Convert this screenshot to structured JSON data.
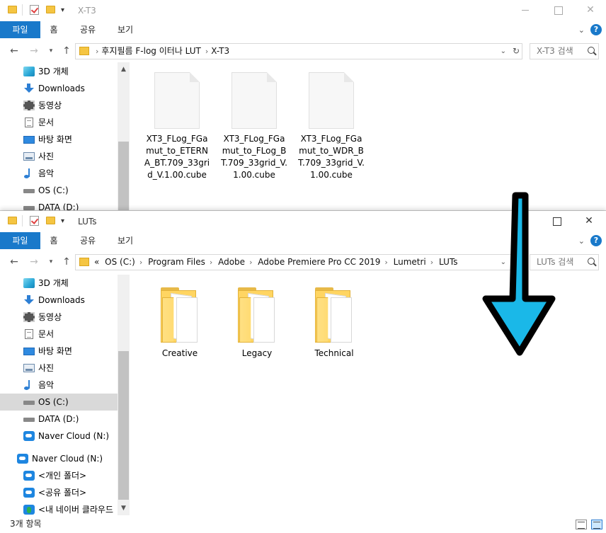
{
  "window_top": {
    "title": "X-T3",
    "ribbon_tabs": [
      "파일",
      "홈",
      "공유",
      "보기"
    ],
    "address_crumbs": [
      "후지필름 F-log 이터나 LUT",
      "X-T3"
    ],
    "search_placeholder": "X-T3 검색",
    "sidebar_items": [
      {
        "label": "3D 개체",
        "icon": "3d-objects-icon"
      },
      {
        "label": "Downloads",
        "icon": "download-icon"
      },
      {
        "label": "동영상",
        "icon": "video-icon"
      },
      {
        "label": "문서",
        "icon": "document-icon"
      },
      {
        "label": "바탕 화면",
        "icon": "desktop-icon"
      },
      {
        "label": "사진",
        "icon": "pictures-icon"
      },
      {
        "label": "음악",
        "icon": "music-icon"
      },
      {
        "label": "OS (C:)",
        "icon": "windows-drive-icon"
      },
      {
        "label": "DATA (D:)",
        "icon": "drive-icon"
      }
    ],
    "files": [
      {
        "name": "XT3_FLog_FGamut_to_ETERNA_BT.709_33grid_V.1.00.cube",
        "icon": "cube-file-icon"
      },
      {
        "name": "XT3_FLog_FGamut_to_FLog_BT.709_33grid_V.1.00.cube",
        "icon": "cube-file-icon"
      },
      {
        "name": "XT3_FLog_FGamut_to_WDR_BT.709_33grid_V.1.00.cube",
        "icon": "cube-file-icon"
      }
    ]
  },
  "window_bottom": {
    "title": "LUTs",
    "ribbon_tabs": [
      "파일",
      "홈",
      "공유",
      "보기"
    ],
    "address_overflow": "«",
    "address_crumbs": [
      "OS (C:)",
      "Program Files",
      "Adobe",
      "Adobe Premiere Pro CC 2019",
      "Lumetri",
      "LUTs"
    ],
    "search_placeholder": "LUTs 검색",
    "sidebar_items": [
      {
        "label": "3D 개체",
        "icon": "3d-objects-icon",
        "level": 1
      },
      {
        "label": "Downloads",
        "icon": "download-icon",
        "level": 1
      },
      {
        "label": "동영상",
        "icon": "video-icon",
        "level": 1
      },
      {
        "label": "문서",
        "icon": "document-icon",
        "level": 1
      },
      {
        "label": "바탕 화면",
        "icon": "desktop-icon",
        "level": 1
      },
      {
        "label": "사진",
        "icon": "pictures-icon",
        "level": 1
      },
      {
        "label": "음악",
        "icon": "music-icon",
        "level": 1
      },
      {
        "label": "OS (C:)",
        "icon": "windows-drive-icon",
        "level": 1,
        "selected": true
      },
      {
        "label": "DATA (D:)",
        "icon": "drive-icon",
        "level": 1
      },
      {
        "label": "Naver Cloud (N:)",
        "icon": "naver-cloud-icon",
        "level": 1
      },
      {
        "label": "Naver Cloud (N:)",
        "icon": "naver-cloud-icon",
        "level": 0
      },
      {
        "label": "<개인 폴더>",
        "icon": "naver-cloud-icon",
        "level": 1
      },
      {
        "label": "<공유 폴더>",
        "icon": "naver-cloud-icon",
        "level": 1
      },
      {
        "label": "<내 네이버 클라우드",
        "icon": "naver-cloud-green-icon",
        "level": 1
      }
    ],
    "folders": [
      {
        "name": "Creative",
        "icon": "folder-icon"
      },
      {
        "name": "Legacy",
        "icon": "folder-icon"
      },
      {
        "name": "Technical",
        "icon": "folder-icon"
      }
    ],
    "status_text": "3개 항목"
  },
  "colors": {
    "ribbon_file_tab": "#1979ca",
    "arrow_fill": "#1ab8e8",
    "arrow_stroke": "#000000",
    "selected_item": "#d9d9d9"
  },
  "annotation": {
    "type": "arrow",
    "direction": "down",
    "icon": "down-arrow-icon"
  }
}
